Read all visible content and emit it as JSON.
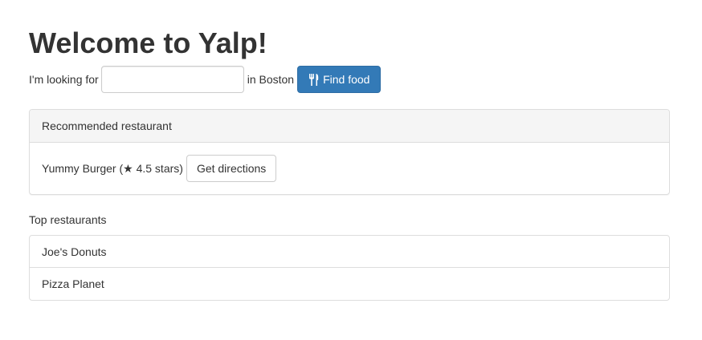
{
  "header": {
    "title": "Welcome to Yalp!"
  },
  "search": {
    "prefix_label": "I'm looking for",
    "value": "",
    "placeholder": "",
    "location_label": "in Boston",
    "button_label": "Find food",
    "button_icon": "cutlery-icon",
    "button_color": "#337ab7"
  },
  "recommended": {
    "heading": "Recommended restaurant",
    "restaurant_text": "Yummy Burger (★ 4.5 stars)",
    "directions_label": "Get directions"
  },
  "top_restaurants": {
    "heading": "Top restaurants",
    "items": [
      {
        "label": "Joe's Donuts"
      },
      {
        "label": "Pizza Planet"
      }
    ]
  }
}
